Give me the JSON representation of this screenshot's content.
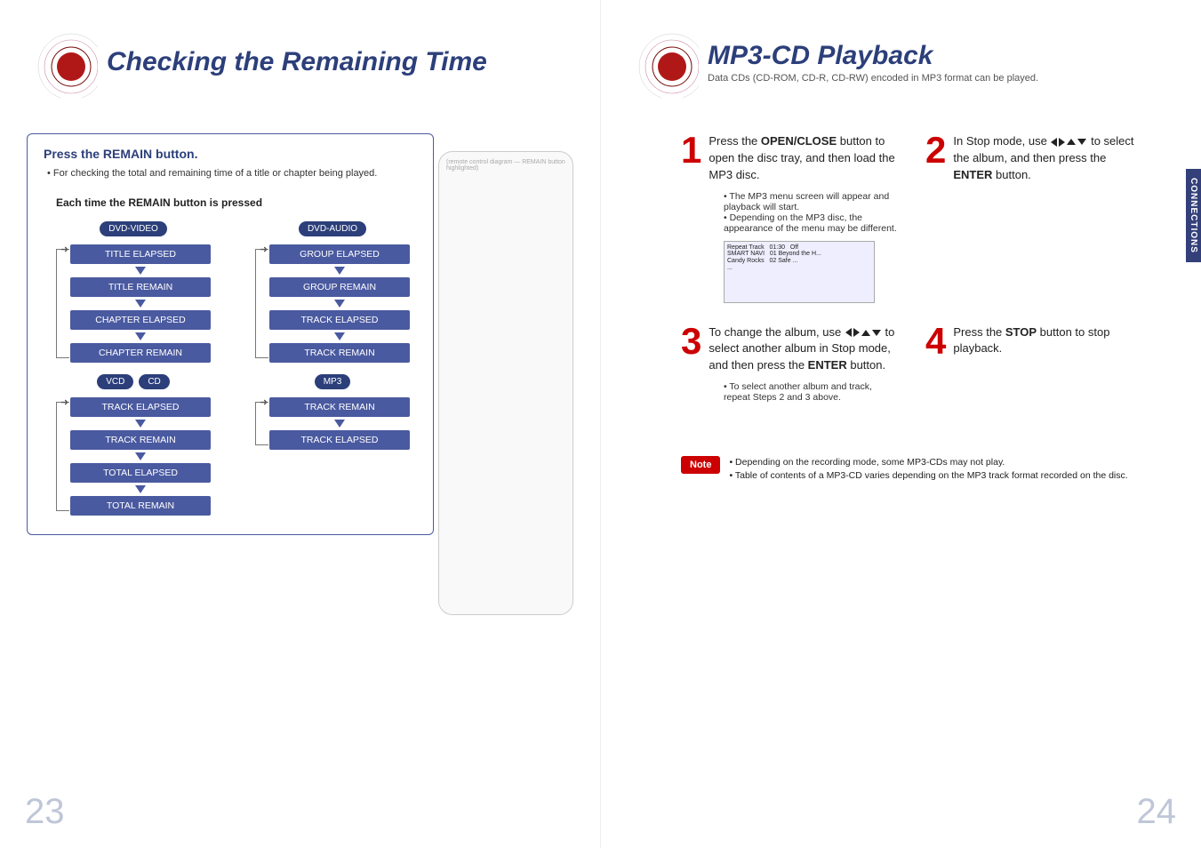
{
  "left": {
    "title": "Checking the Remaining Time",
    "box_heading": "Press the REMAIN button.",
    "box_bullet": "For checking the total and remaining time of a title or chapter being played.",
    "each_time": "Each time the REMAIN button is pressed",
    "cols": [
      {
        "cats": [
          "DVD-VIDEO"
        ],
        "states": [
          "TITLE ELAPSED",
          "TITLE REMAIN",
          "CHAPTER ELAPSED",
          "CHAPTER REMAIN"
        ]
      },
      {
        "cats": [
          "DVD-AUDIO"
        ],
        "states": [
          "GROUP ELAPSED",
          "GROUP REMAIN",
          "TRACK ELAPSED",
          "TRACK REMAIN"
        ]
      },
      {
        "cats": [
          "VCD",
          "CD"
        ],
        "states": [
          "TRACK ELAPSED",
          "TRACK REMAIN",
          "TOTAL ELAPSED",
          "TOTAL REMAIN"
        ]
      },
      {
        "cats": [
          "MP3"
        ],
        "states": [
          "TRACK REMAIN",
          "TRACK ELAPSED"
        ]
      }
    ],
    "page_num": "23"
  },
  "right": {
    "title": "MP3-CD Playback",
    "subhead": "Data CDs (CD-ROM, CD-R, CD-RW) encoded in MP3 format can be played.",
    "steps": {
      "s1": {
        "text_a": "Press the ",
        "bold1": "OPEN/CLOSE",
        "text_b": " button to open the disc tray, and then load the MP3 disc.",
        "sub1": "The MP3 menu screen will appear and playback will start.",
        "sub2": "Depending on the MP3 disc, the appearance of the menu may be different."
      },
      "s2": {
        "text_a": "In Stop mode, use ",
        "text_b": " to select the album, and then press the ",
        "bold1": "ENTER",
        "text_c": " button."
      },
      "s3": {
        "text_a": "To change the album, use ",
        "text_b": " to select another album in Stop mode, and then press the ",
        "bold1": "ENTER",
        "text_c": " button.",
        "sub1": "To select another album and track, repeat Steps 2 and 3 above."
      },
      "s4": {
        "text_a": "Press the ",
        "bold1": "STOP",
        "text_b": " button to stop playback."
      }
    },
    "note_label": "Note",
    "note1": "Depending on the recording mode, some MP3-CDs may not play.",
    "note2": "Table of contents of a MP3-CD varies depending on the MP3 track format recorded on the disc.",
    "side_tab": "CONNECTIONS",
    "page_num": "24"
  }
}
